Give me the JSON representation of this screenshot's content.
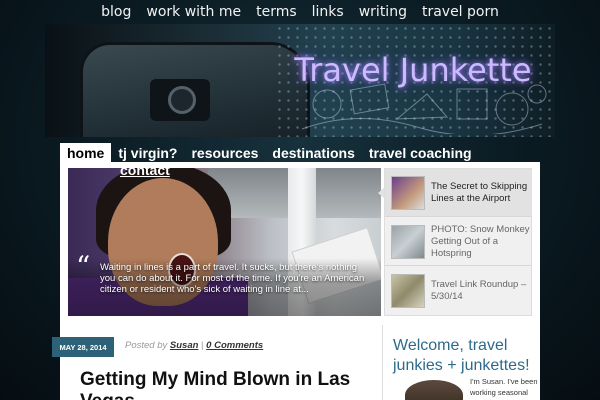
{
  "top_nav": [
    "blog",
    "work with me",
    "terms",
    "links",
    "writing",
    "travel porn"
  ],
  "header": {
    "logo_text": "Travel Junkette"
  },
  "main_nav": {
    "items": [
      "home",
      "tj virgin?",
      "resources",
      "destinations",
      "travel coaching"
    ],
    "overflow_item": "contact",
    "active": "home"
  },
  "slider": {
    "caption": "Waiting in lines is a part of travel. It sucks, but there's nothing you can do about it. For most of the time. If you're an American citizen or resident who's sick of waiting in line at...",
    "items": [
      {
        "title": "The Secret to Skipping Lines at the Airport",
        "active": true
      },
      {
        "title": "PHOTO: Snow Monkey Getting Out of a Hotspring",
        "active": false
      },
      {
        "title": "Travel Link Roundup – 5/30/14",
        "active": false
      }
    ]
  },
  "post": {
    "date": "MAY 28, 2014",
    "posted_by_label": "Posted by",
    "author": "Susan",
    "separator": "|",
    "comments": "0 Comments",
    "title": "Getting My Mind Blown in Las Vegas"
  },
  "sidebar": {
    "welcome": "Welcome, travel junkies + junkettes!",
    "bio": "I'm Susan. I've been working seasonal"
  },
  "colors": {
    "accent": "#2d6177",
    "welcome_text": "#2d6b8a",
    "logo_glow": "#cdb9ff",
    "background": "#0c1d25"
  }
}
